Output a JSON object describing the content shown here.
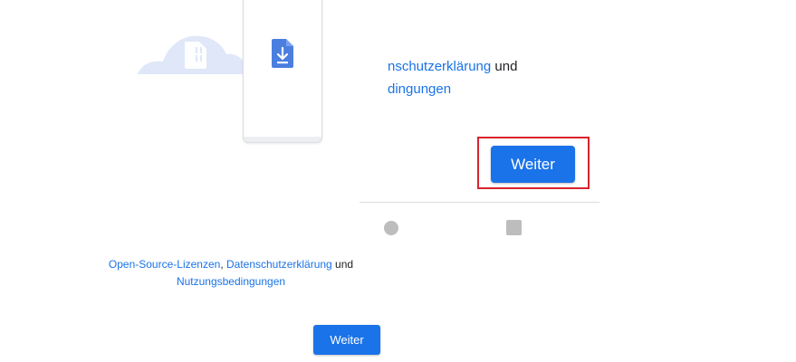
{
  "zoom": {
    "line1_link": "nschutzerklärung",
    "line1_suffix": " und",
    "line2_link": "dingungen",
    "continue_label": "Weiter"
  },
  "legal": {
    "open_source": "Open-Source-Lizenzen",
    "comma": ", ",
    "privacy": "Datenschutzerklärung",
    "and": " und",
    "terms": "Nutzungsbedingungen"
  },
  "main": {
    "continue_label": "Weiter"
  },
  "colors": {
    "accent": "#1a73e8",
    "highlight": "#d9232e",
    "cloud": "#dfe7f8"
  },
  "icons": {
    "cloud": "cloud-icon",
    "sim": "sim-card-icon",
    "file_download": "file-download-icon",
    "home": "home-nav-icon",
    "recents": "recents-nav-icon"
  }
}
